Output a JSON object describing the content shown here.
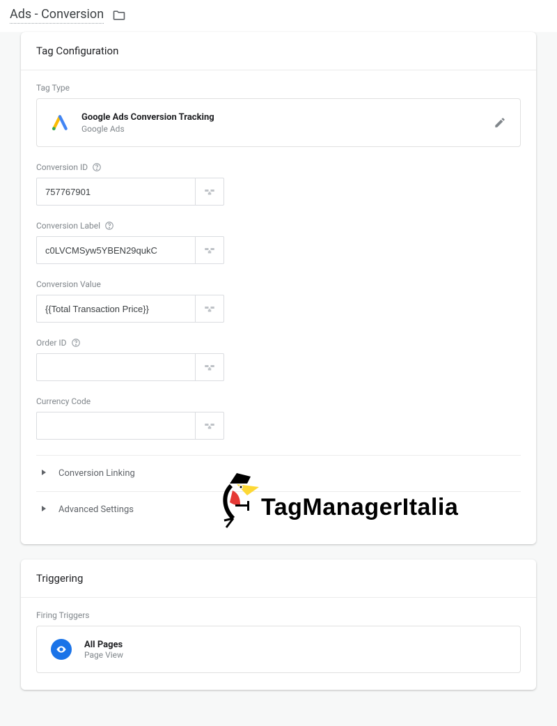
{
  "header": {
    "title": "Ads - Conversion"
  },
  "tag_config": {
    "panel_title": "Tag Configuration",
    "tag_type_label": "Tag Type",
    "tag_type_title": "Google Ads Conversion Tracking",
    "tag_type_provider": "Google Ads",
    "fields": {
      "conversion_id": {
        "label": "Conversion ID",
        "value": "757767901"
      },
      "conversion_label": {
        "label": "Conversion Label",
        "value": "c0LVCMSyw5YBEN29qukC"
      },
      "conversion_value": {
        "label": "Conversion Value",
        "value": "{{Total Transaction Price}}"
      },
      "order_id": {
        "label": "Order ID",
        "value": ""
      },
      "currency_code": {
        "label": "Currency Code",
        "value": ""
      }
    },
    "expanders": {
      "conversion_linking": "Conversion Linking",
      "advanced": "Advanced Settings"
    }
  },
  "triggering": {
    "panel_title": "Triggering",
    "section_label": "Firing Triggers",
    "trigger": {
      "name": "All Pages",
      "type": "Page View"
    }
  },
  "watermark": {
    "text_a": "TagManager",
    "text_b": "Italia"
  }
}
